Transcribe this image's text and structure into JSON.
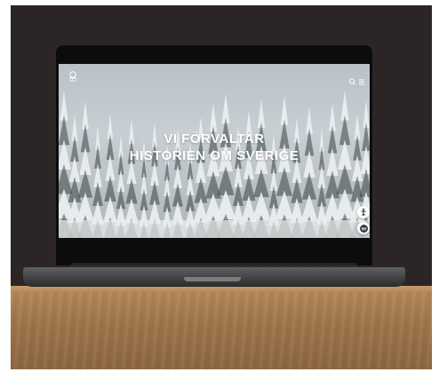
{
  "hero": {
    "headline_line1": "VI FÖRVALTAR",
    "headline_line2": "HISTORIEN OM SVERIGE"
  },
  "header": {
    "logo_icon": "crown-emblem-icon",
    "search_icon": "search-icon",
    "menu_icon": "hamburger-menu-icon"
  },
  "floating_buttons": {
    "accessibility_icon": "accessibility-icon",
    "chat_icon": "chat-icon"
  },
  "colors": {
    "backdrop": "#2b2625",
    "sky": "#c4cbd0",
    "snow_trees": "#e9edee",
    "tree_dark": "#3a463f",
    "wood": "#a57a4d",
    "headline": "#ffffff"
  }
}
